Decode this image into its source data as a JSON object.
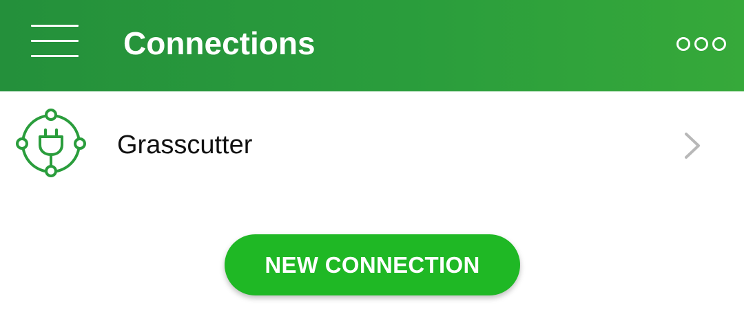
{
  "header": {
    "menu_icon": "hamburger-menu-icon",
    "title": "Connections",
    "overflow_icon": "more-options-icon",
    "background_color": "#2a9d3c"
  },
  "connections": [
    {
      "icon": "plug-connection-icon",
      "label": "Grasscutter",
      "chevron_icon": "chevron-right-icon"
    }
  ],
  "actions": {
    "new_connection_label": "NEW CONNECTION",
    "button_color": "#1fb825"
  }
}
